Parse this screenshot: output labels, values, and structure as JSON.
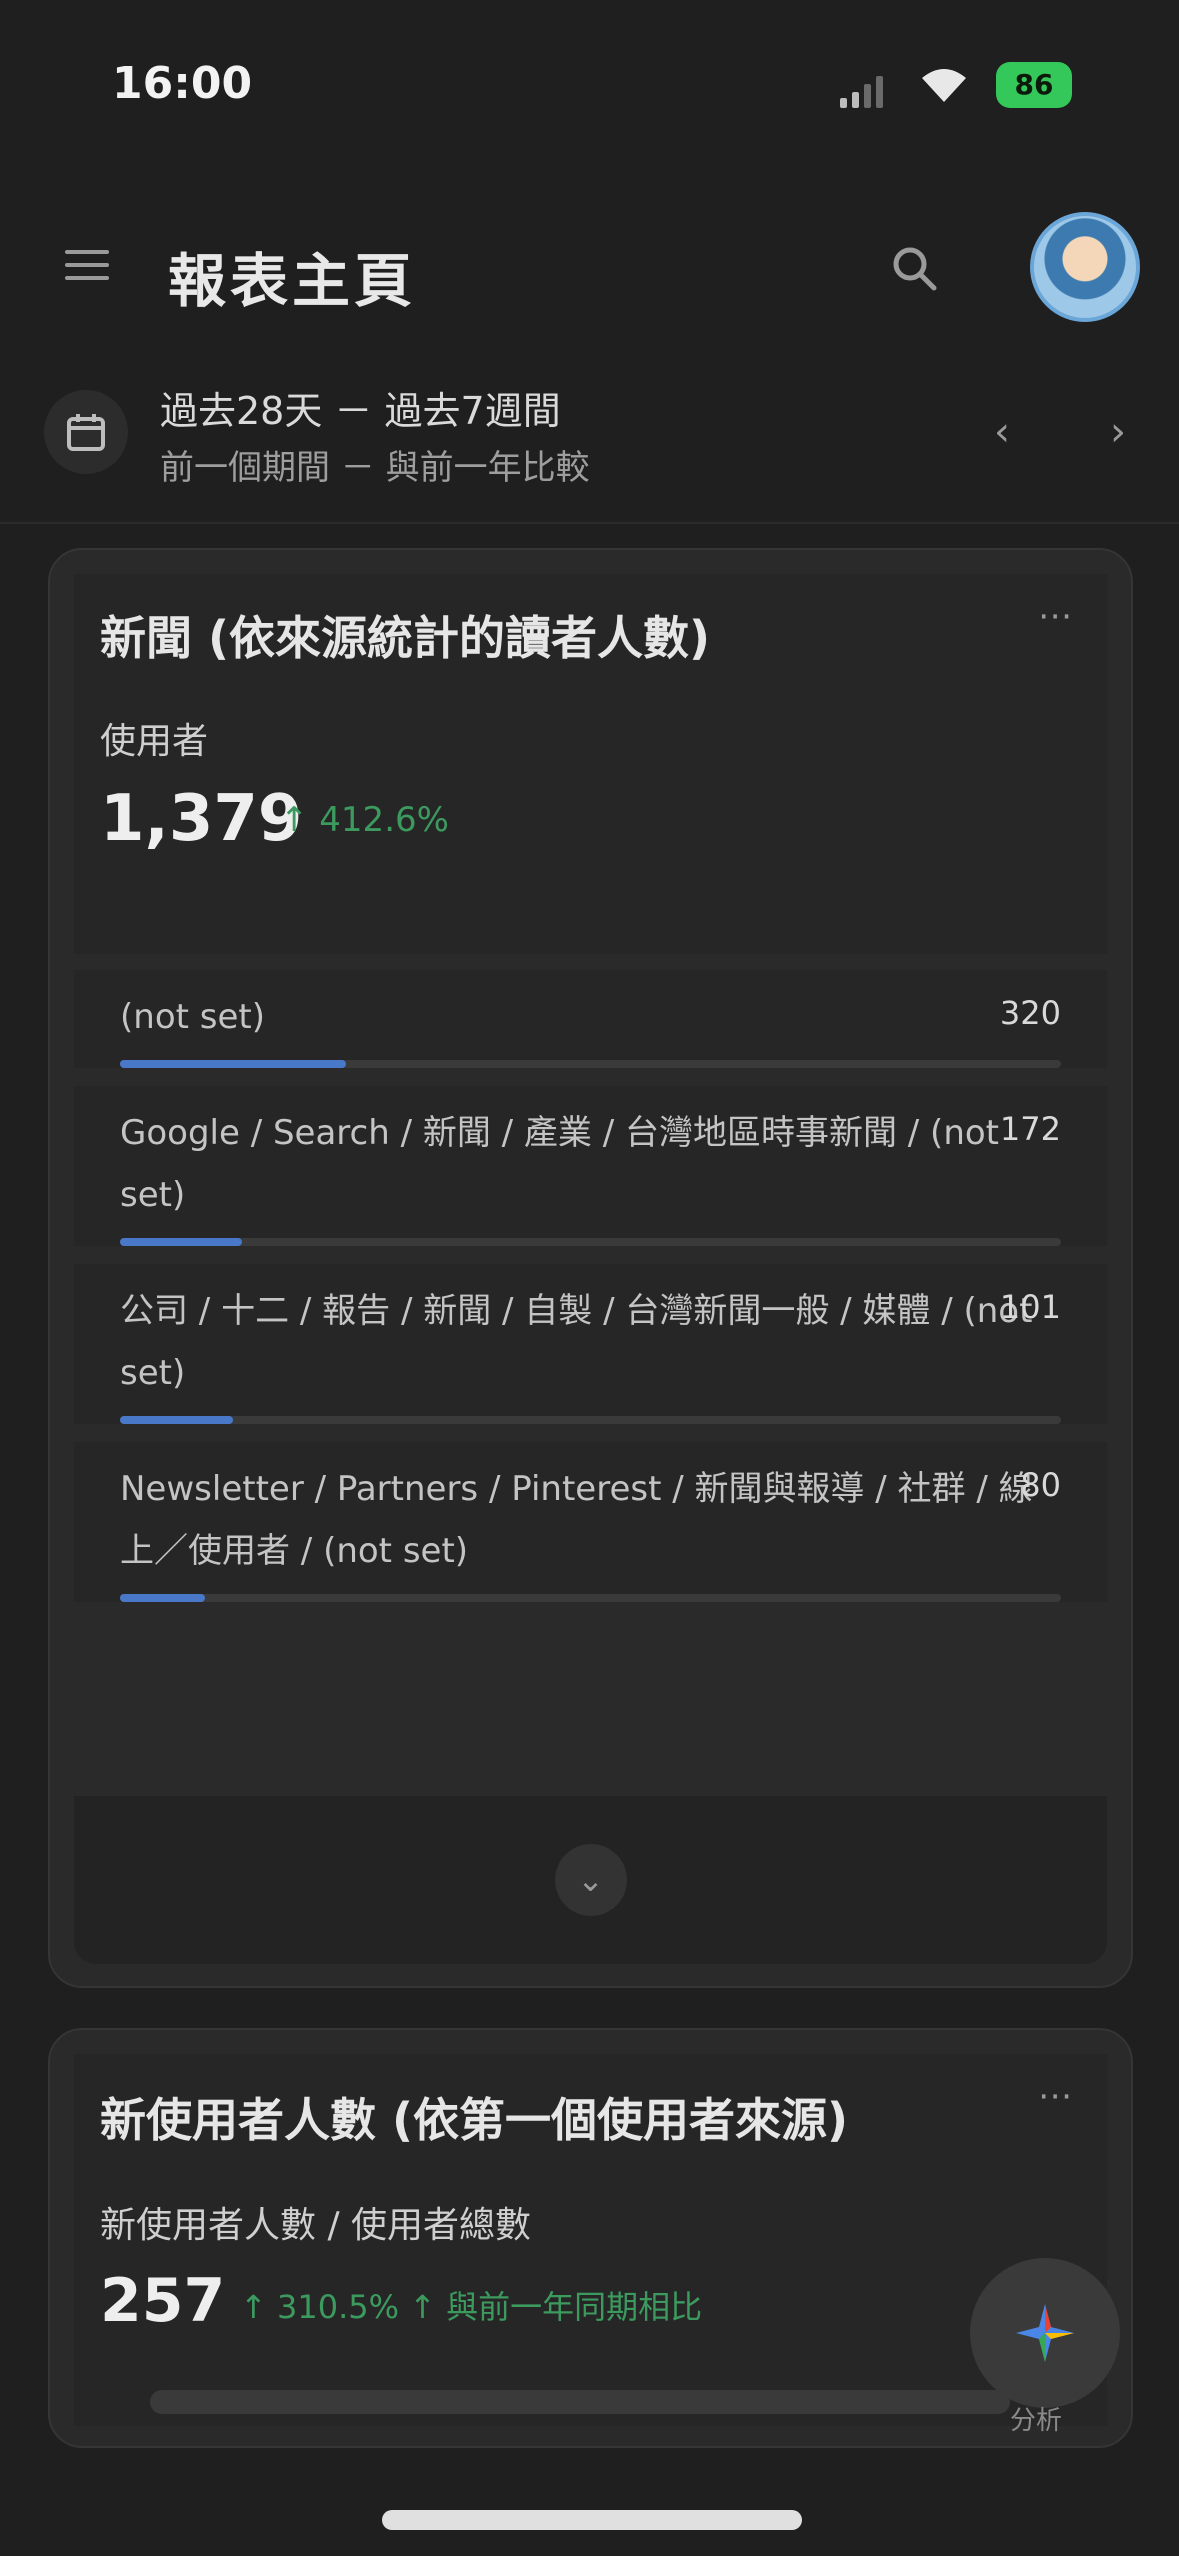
{
  "status_bar": {
    "time": "16:00",
    "battery": "86"
  },
  "app_bar": {
    "title": "報表主頁"
  },
  "date_range": {
    "current": "過去28天 － 過去7週間",
    "comparison": "前一個期間 － 與前一年比較"
  },
  "card1": {
    "title": "新聞 (依來源統計的讀者人數)",
    "metric_label": "使用者",
    "metric_value": "1,379",
    "metric_change": "↑ 412.6%",
    "rows": [
      {
        "label": "(not set)",
        "count": "320",
        "fraction": 0.24
      },
      {
        "label": "Google / Search / 新聞 / 產業 / 台灣地區時事新聞 / (not set)",
        "count": "172",
        "fraction": 0.13
      },
      {
        "label": "公司 / 十二 / 報告 / 新聞 / 自製 / 台灣新聞一般 / 媒體 / (not set)",
        "count": "101",
        "fraction": 0.12
      },
      {
        "label": "Newsletter / Partners / Pinterest / 新聞與報導 / 社群 / 線上／使用者 / (not set)",
        "count": "80",
        "fraction": 0.09
      }
    ]
  },
  "card2": {
    "title": "新使用者人數 (依第一個使用者來源)",
    "metric_label": "新使用者人數 / 使用者總數",
    "metric_value": "257",
    "metric_change": "↑ 310.5% ↑ 與前一年同期相比"
  },
  "fab": {
    "label": "分析"
  },
  "colors": {
    "background": "#1f1f1f",
    "card": "#2a2a2a",
    "accent": "#4a78c9",
    "positive": "#3c9a5f",
    "battery": "#34c759"
  },
  "icons": [
    "menu-icon",
    "search-icon",
    "calendar-icon",
    "chevron-left-icon",
    "chevron-right-icon",
    "more-icon",
    "expand-icon",
    "insights-icon"
  ]
}
